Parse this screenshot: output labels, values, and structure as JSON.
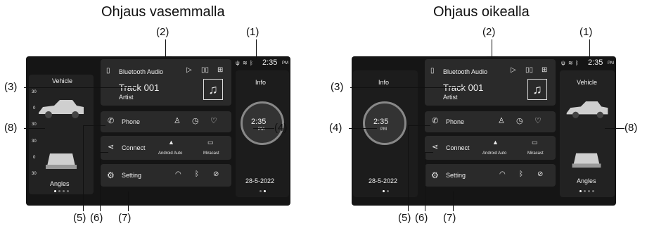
{
  "panels": [
    {
      "title": "Ohjaus vasemmalla",
      "vehicle_label": "Vehicle",
      "angles_label": "Angles",
      "info_label": "Info",
      "date": "28-5-2022"
    },
    {
      "title": "Ohjaus oikealla",
      "vehicle_label": "Vehicle",
      "angles_label": "Angles",
      "info_label": "Info",
      "date": "28-5-2022"
    }
  ],
  "status_time": "2:35",
  "status_ampm": "PM",
  "clock": {
    "time": "2:35",
    "ampm": "PM"
  },
  "media": {
    "source": "Bluetooth Audio",
    "track": "Track 001",
    "artist": "Artist"
  },
  "phone_label": "Phone",
  "connect": {
    "label": "Connect",
    "android_auto": "Android Auto",
    "miracast": "Miracast"
  },
  "setting_label": "Setting",
  "gauge_ticks": [
    "30",
    "0",
    "30",
    "30",
    "0",
    "30"
  ],
  "callouts": {
    "c1": "(1)",
    "c2": "(2)",
    "c3": "(3)",
    "c4": "(4)",
    "c5": "(5)",
    "c6": "(6)",
    "c7": "(7)",
    "c8": "(8)"
  },
  "icons": [
    "bluetooth-audio-icon",
    "play-icon",
    "pause-icon",
    "grid-icon",
    "music-note-icon",
    "phone-icon",
    "contact-icon",
    "history-icon",
    "heart-icon",
    "share-icon",
    "android-auto-icon",
    "miracast-icon",
    "gear-icon",
    "wifi-icon",
    "bluetooth-icon",
    "mute-icon",
    "usb-icon",
    "signal-icon"
  ]
}
